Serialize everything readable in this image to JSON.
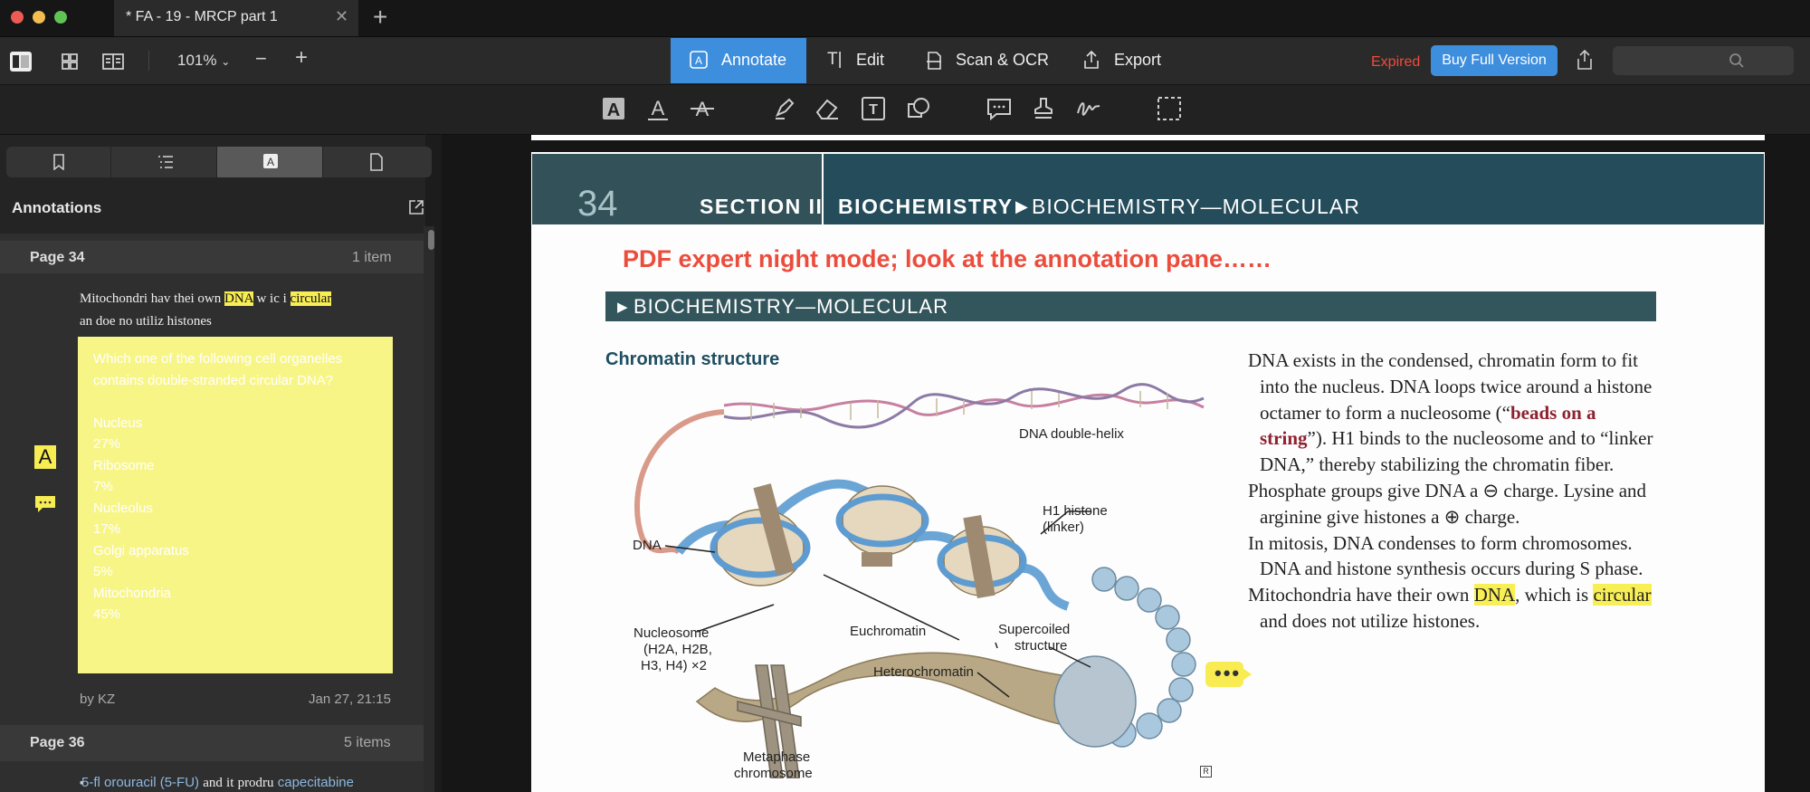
{
  "window": {
    "tab_title": "* FA - 19 - MRCP part 1",
    "colors": {
      "close": "#ec5c55",
      "minimize": "#f4bd4f",
      "maximize": "#60c454"
    }
  },
  "toolbar": {
    "zoom": "101%",
    "zoom_out": "−",
    "zoom_in": "+",
    "modes": [
      {
        "label": "Annotate"
      },
      {
        "label": "Edit"
      },
      {
        "label": "Scan & OCR"
      },
      {
        "label": "Export"
      }
    ],
    "expired": "Expired",
    "buy": "Buy Full Version",
    "accent": "#3e8ede"
  },
  "sidebar": {
    "header": "Annotations",
    "page34": {
      "label": "Page 34",
      "count": "1 item",
      "quote_parts": [
        "Mitochondri",
        "hav",
        "thei",
        "own",
        "DNA",
        "w",
        "ic",
        "i",
        "circular",
        "an",
        "doe",
        "no",
        "utiliz",
        "histones"
      ],
      "note": "Which one of the following cell organelles contains double-stranded circular DNA?\n\nNucleus\n27%\nRibosome\n7%\nNucleolus\n17%\nGolgi apparatus\n5%\nMitochondria\n45%",
      "author": "by KZ",
      "date": "Jan 27, 21:15"
    },
    "page36": {
      "label": "Page 36",
      "count": "5 items",
      "parts": [
        "5-fl orouracil (5-FU)",
        "and",
        "it",
        "prodru",
        "capecitabine"
      ]
    }
  },
  "document": {
    "page_number": "34",
    "section": "SECTION II",
    "subject": "BIOCHEMISTRY",
    "crumb": "BIOCHEMISTRY—MOLECULAR",
    "overlay_note": "PDF expert night mode; look at the annotation pane……",
    "band": "BIOCHEMISTRY—MOLECULAR",
    "figure_title": "Chromatin structure",
    "figure_labels": {
      "helix": "DNA double-helix",
      "h1": "H1 histone",
      "h1b": "(linker)",
      "dna": "DNA",
      "nucleosome": "Nucleosome",
      "nucleosome2": "(H2A, H2B,",
      "nucleosome3": "H3, H4) ×2",
      "euchromatin": "Euchromatin",
      "supercoiled": "Supercoiled",
      "supercoiled2": "structure",
      "heterochromatin": "Heterochromatin",
      "metaphase": "Metaphase",
      "metaphase2": "chromosome"
    },
    "text": {
      "p1a": "DNA exists in the condensed, chromatin form to fit into the nucleus. DNA loops twice around a histone octamer to form a nucleosome (“",
      "p1b": "beads on a string",
      "p1c": "”). H1 binds to the nucleosome and to “linker DNA,” thereby stabilizing the chromatin fiber.",
      "p2": "Phosphate groups give DNA a ⊖ charge. Lysine and arginine give histones a ⊕ charge.",
      "p3": "In mitosis, DNA condenses to form chromosomes. DNA and histone synthesis occurs during S phase.",
      "p4a": "Mitochondria have their own ",
      "p4b": "DNA",
      "p4c": ", which is ",
      "p4d": "circular",
      "p4e": " and does not utilize histones."
    }
  }
}
